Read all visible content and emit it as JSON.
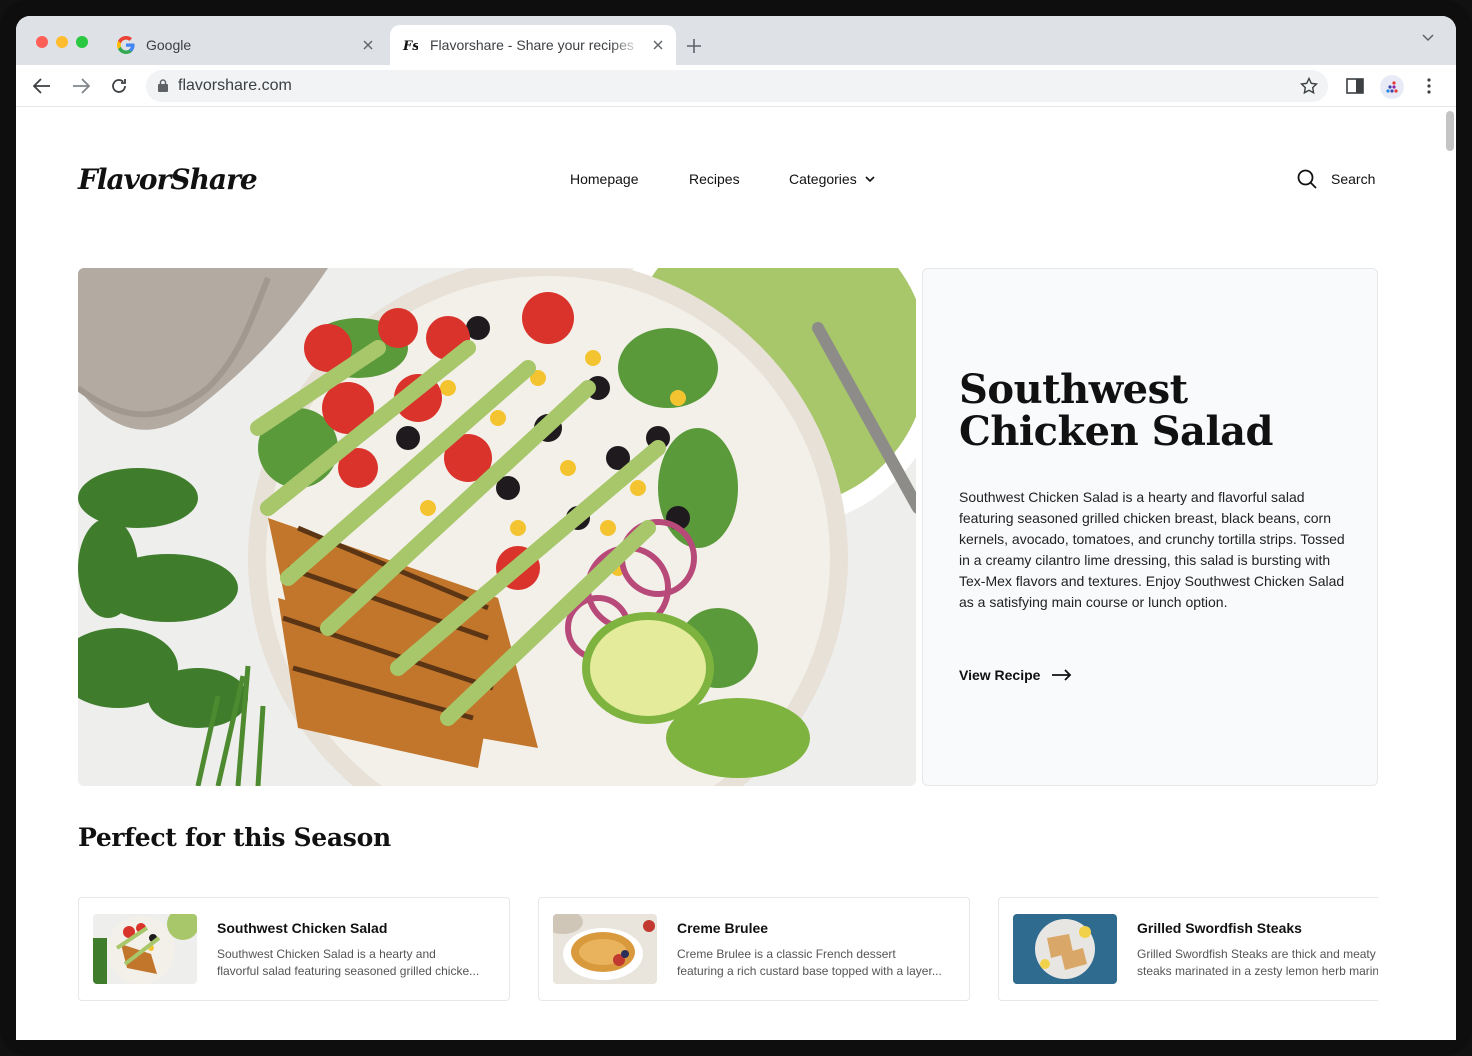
{
  "browser": {
    "tabs": [
      {
        "title": "Google",
        "favicon": "google-g-icon"
      },
      {
        "title": "Flavorshare - Share your recipes",
        "favicon": "flavorshare-icon"
      }
    ],
    "url": "flavorshare.com"
  },
  "site": {
    "logo": "FlavorShare",
    "nav": {
      "home": "Homepage",
      "recipes": "Recipes",
      "categories": "Categories"
    },
    "search_label": "Search"
  },
  "hero": {
    "title": "Southwest Chicken Salad",
    "description": "Southwest Chicken Salad is a hearty and flavorful salad featuring seasoned grilled chicken breast, black beans, corn kernels, avocado, tomatoes, and crunchy tortilla strips. Tossed in a creamy cilantro lime dressing, this salad is bursting with Tex-Mex flavors and textures. Enjoy Southwest Chicken Salad as a satisfying main course or lunch option.",
    "cta": "View Recipe"
  },
  "season": {
    "title": "Perfect for this Season",
    "cards": [
      {
        "title": "Southwest Chicken Salad",
        "line1": "Southwest Chicken Salad is a hearty and",
        "line2": "flavorful salad featuring seasoned grilled chicke..."
      },
      {
        "title": "Creme Brulee",
        "line1": "Creme Brulee is a classic French dessert",
        "line2": "featuring a rich custard base topped with a layer..."
      },
      {
        "title": "Grilled Swordfish Steaks",
        "line1": "Grilled Swordfish Steaks are thick and meaty",
        "line2": "steaks marinated in a zesty lemon herb marinade"
      }
    ]
  },
  "colors": {
    "accent": "#111111",
    "panel_bg": "#f8fafc",
    "dressing": "#a8c76a",
    "tomato": "#d9332b",
    "corn": "#f4c430"
  }
}
